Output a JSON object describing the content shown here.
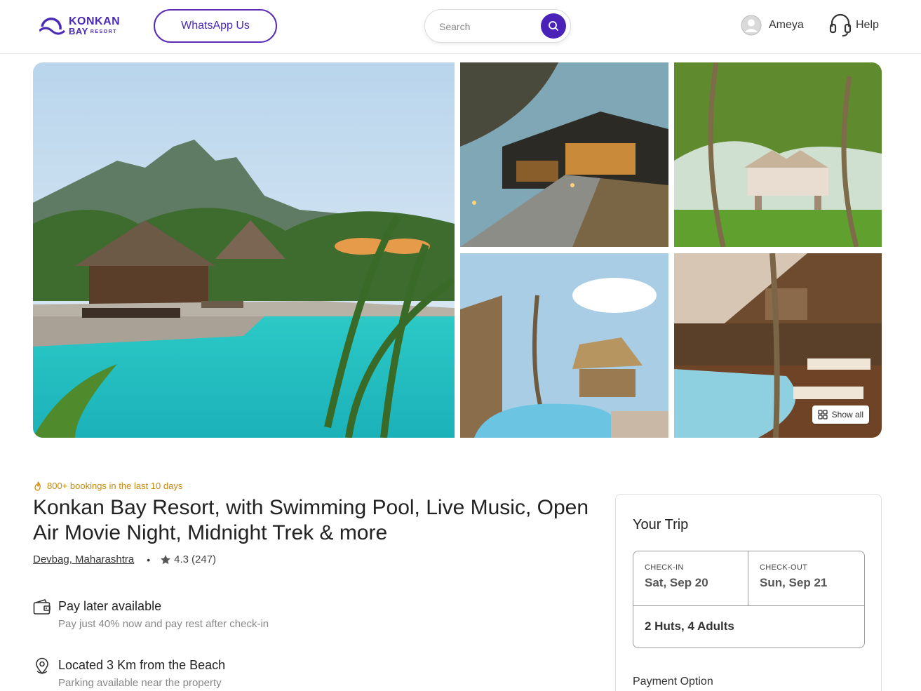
{
  "header": {
    "logo_top": "KONKAN",
    "logo_bottom": "BAY",
    "logo_small": "RESORT",
    "whatsapp_label": "WhatsApp Us",
    "search_placeholder": "Search",
    "user_name": "Ameya",
    "help_label": "Help",
    "accent_color": "#4a22b8"
  },
  "gallery": {
    "show_all_label": "Show all"
  },
  "listing": {
    "bookings_note": "800+ bookings in the last 10 days",
    "title": "Konkan Bay Resort, with Swimming Pool, Live Music, Open Air Movie Night, Midnight Trek & more",
    "location": "Devbag, Maharashtra",
    "rating": "4.3",
    "reviews": "(247)",
    "features": [
      {
        "title": "Pay later available",
        "subtitle": "Pay just 40% now and pay rest after check-in",
        "icon": "wallet-icon"
      },
      {
        "title": "Located 3 Km from the Beach",
        "subtitle": "Parking available near the property",
        "icon": "location-pin-icon"
      }
    ]
  },
  "trip": {
    "title": "Your Trip",
    "checkin_label": "CHECK-IN",
    "checkin_date": "Sat, Sep 20",
    "checkout_label": "CHECK-OUT",
    "checkout_date": "Sun, Sep 21",
    "guests": "2 Huts, 4 Adults",
    "payment_label": "Payment Option"
  }
}
